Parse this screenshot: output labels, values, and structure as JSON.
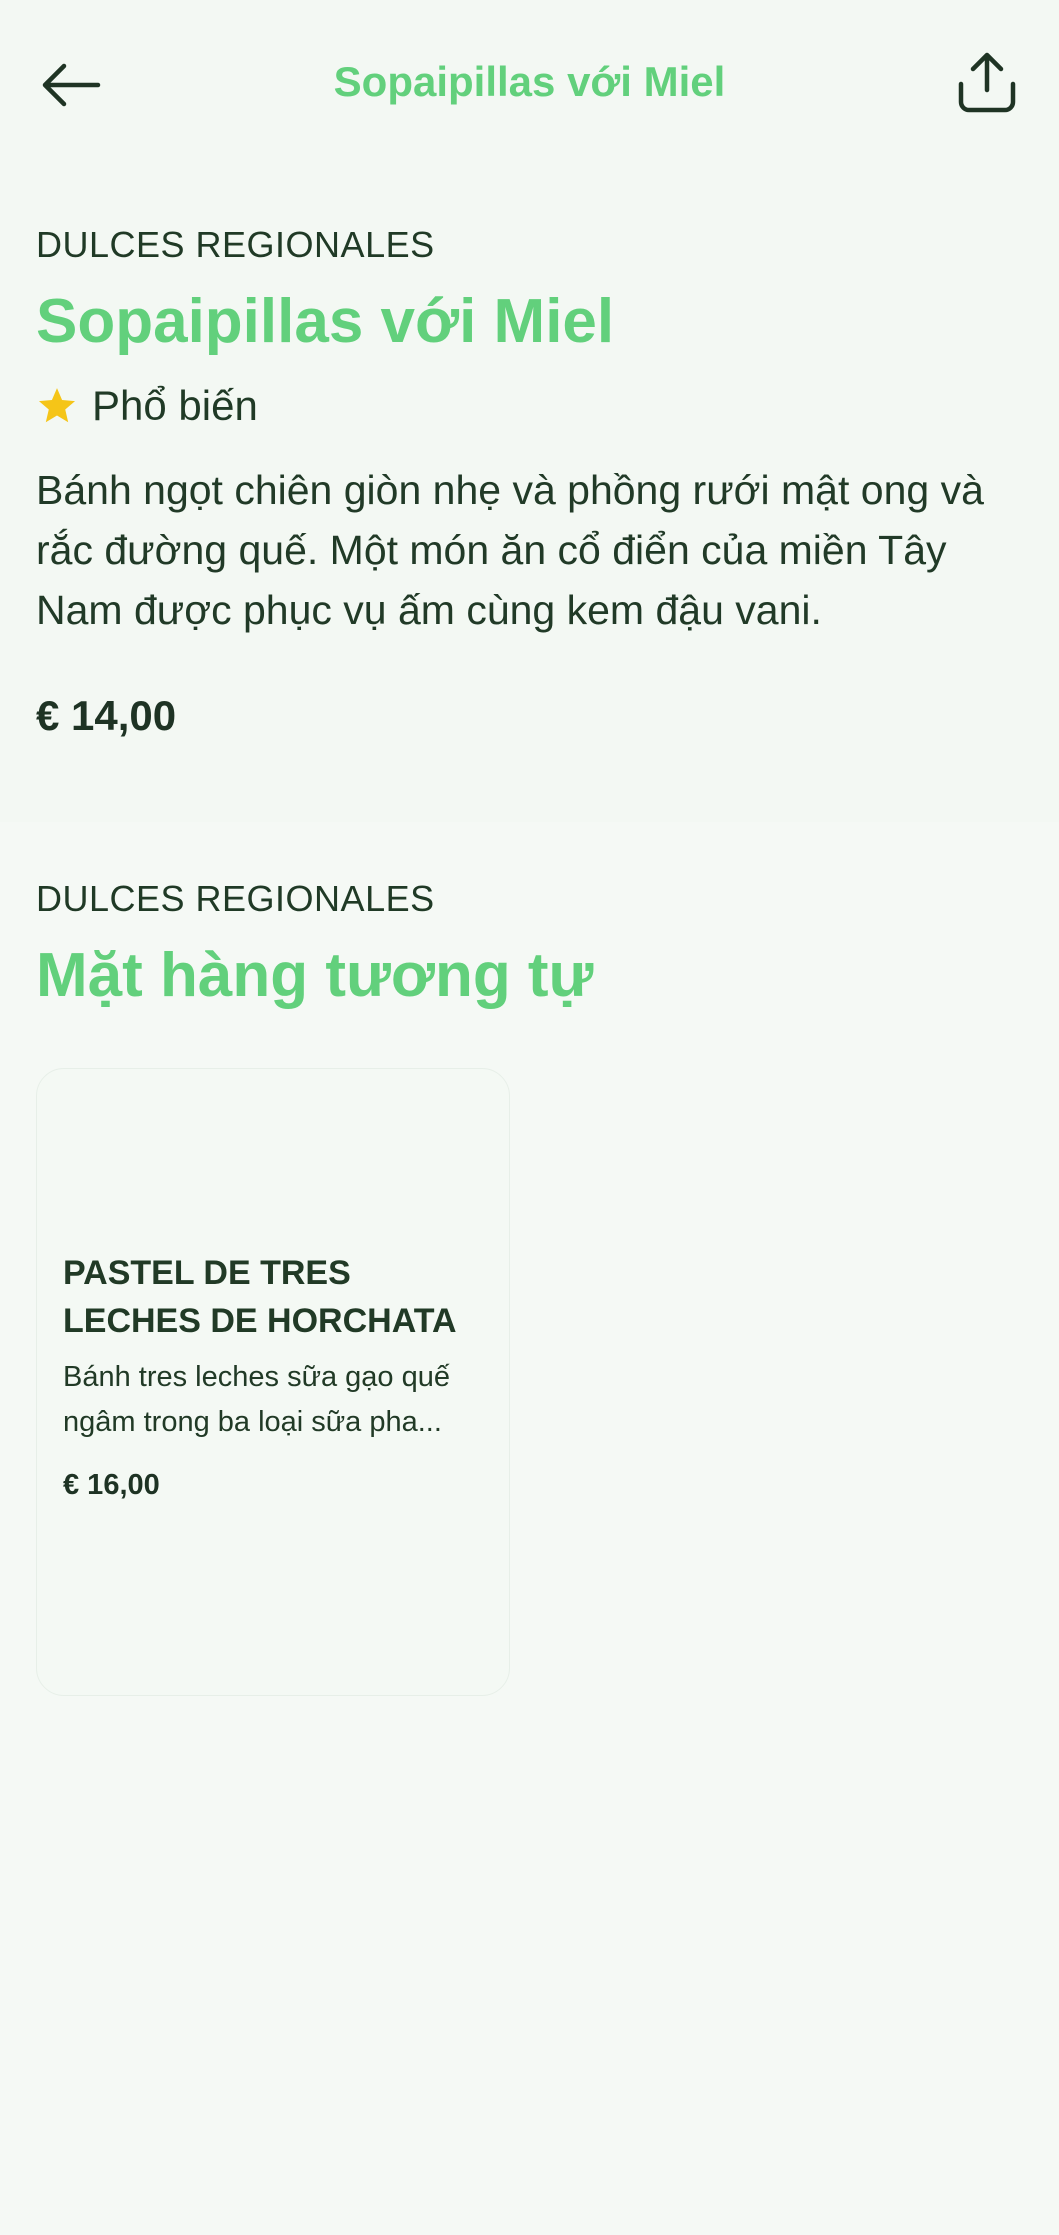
{
  "colors": {
    "background": "#f3f8f3",
    "accent": "#62d07c",
    "text": "#1f3424",
    "star": "#f5c518"
  },
  "header": {
    "title": "Sopaipillas với Miel",
    "back_icon": "arrow-left-icon",
    "share_icon": "share-upload-icon"
  },
  "item": {
    "category": "DULCES REGIONALES",
    "name": "Sopaipillas với Miel",
    "badge_icon": "star-icon",
    "badge_label": "Phổ biến",
    "description": "Bánh ngọt chiên giòn nhẹ và phồng rưới mật ong và rắc đường quế. Một món ăn cổ điển của miền Tây Nam được phục vụ ấm cùng kem đậu vani.",
    "price": "€ 14,00"
  },
  "similar": {
    "category": "DULCES REGIONALES",
    "heading": "Mặt hàng tương tự",
    "items": [
      {
        "name": "PASTEL DE TRES LECHES DE HORCHATA",
        "description": "Bánh tres leches sữa gạo quế ngâm trong ba loại sữa pha...",
        "price": "€ 16,00"
      }
    ]
  }
}
